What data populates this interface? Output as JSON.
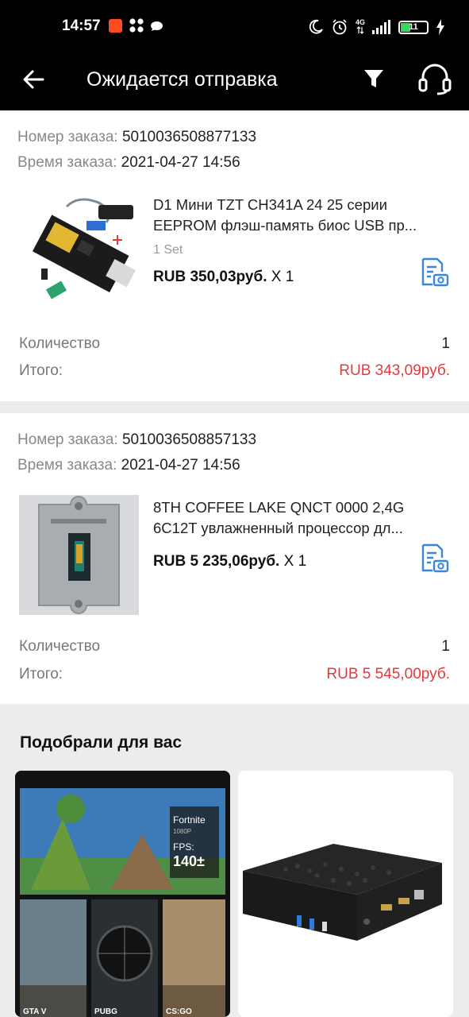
{
  "status_bar": {
    "time": "14:57",
    "network": "4G",
    "battery_level": "11"
  },
  "header": {
    "title": "Ожидается отправка",
    "back_icon": "arrow-left-icon",
    "filter_icon": "filter-icon",
    "support_icon": "headset-icon"
  },
  "orders": [
    {
      "number_label": "Номер заказа:",
      "number": "5010036508877133",
      "time_label": "Время заказа:",
      "time": "2021-04-27 14:56",
      "product_lines": [
        "D1 Мини TZT CH341A 24 25 серии",
        "EEPROM флэш-память биос USB пр..."
      ],
      "variant": "1 Set",
      "price": "RUB 350,03руб.",
      "qty_mult": "X 1",
      "quantity_label": "Количество",
      "quantity": "1",
      "total_label": "Итого:",
      "total": "RUB 343,09руб."
    },
    {
      "number_label": "Номер заказа:",
      "number": "5010036508857133",
      "time_label": "Время заказа:",
      "time": "2021-04-27 14:56",
      "product_lines": [
        "8TH COFFEE LAKE QNCT 0000 2,4G",
        "6C12T увлажненный процессор дл..."
      ],
      "variant": "",
      "price": "RUB 5 235,06руб.",
      "qty_mult": "X 1",
      "quantity_label": "Количество",
      "quantity": "1",
      "total_label": "Итого:",
      "total": "RUB 5 545,00руб."
    }
  ],
  "recommendations": {
    "title": "Подобрали для вас",
    "tile1": {
      "overlay_game": "Fortnite",
      "overlay_res": "1080P",
      "overlay_fps_label": "FPS:",
      "overlay_fps": "140±",
      "captions": [
        "GTA V",
        "PUBG",
        "CS:GO"
      ]
    }
  },
  "colors": {
    "accent_red": "#e4393c",
    "icon_blue": "#3b86d8",
    "bar_bg": "#000000"
  }
}
